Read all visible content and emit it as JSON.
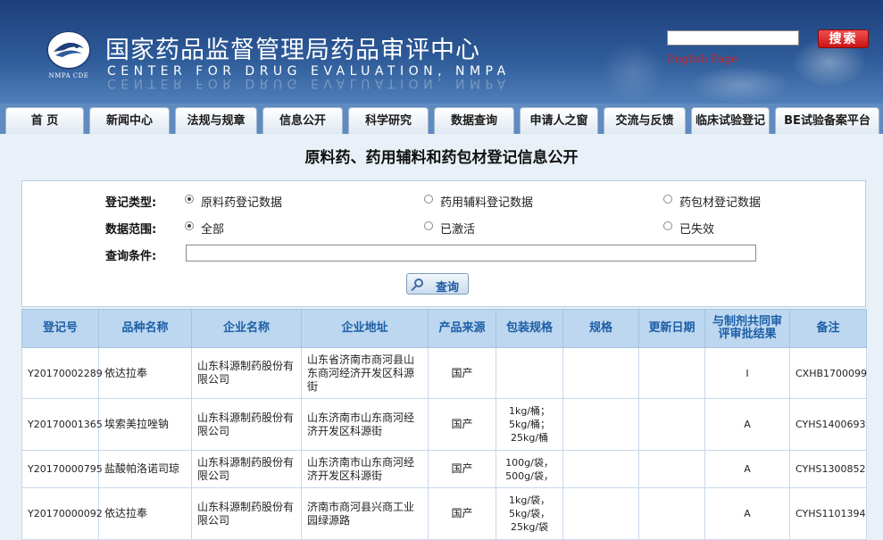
{
  "header": {
    "logo_caption": "NMPA CDE",
    "title_cn": "国家药品监督管理局药品审评中心",
    "title_en": "CENTER FOR DRUG EVALUATION, NMPA",
    "search_placeholder": "",
    "search_button": "搜索",
    "english_link": "English Page"
  },
  "nav": {
    "items": [
      "首 页",
      "新闻中心",
      "法规与规章",
      "信息公开",
      "科学研究",
      "数据查询",
      "申请人之窗",
      "交流与反馈",
      "临床试验登记",
      "BE试验备案平台"
    ]
  },
  "page_title": "原料药、药用辅料和药包材登记信息公开",
  "form": {
    "type_label": "登记类型:",
    "type_options": [
      "原料药登记数据",
      "药用辅料登记数据",
      "药包材登记数据"
    ],
    "type_selected": 0,
    "range_label": "数据范围:",
    "range_options": [
      "全部",
      "已激活",
      "已失效"
    ],
    "range_selected": 0,
    "query_label": "查询条件:",
    "query_value": "",
    "query_button": "查询"
  },
  "table": {
    "headers": [
      "登记号",
      "品种名称",
      "企业名称",
      "企业地址",
      "产品来源",
      "包装规格",
      "规格",
      "更新日期",
      "与制剂共同审评审批结果",
      "备注"
    ],
    "rows": [
      [
        "Y20170002289",
        "依达拉奉",
        "山东科源制药股份有限公司",
        "山东省济南市商河县山东商河经济开发区科源街",
        "国产",
        "",
        "",
        "",
        "I",
        "CXHB1700099"
      ],
      [
        "Y20170001365",
        "埃索美拉唑钠",
        "山东科源制药股份有限公司",
        "山东济南市山东商河经济开发区科源街",
        "国产",
        "1kg/桶；5kg/桶；25kg/桶",
        "",
        "",
        "A",
        "CYHS1400693"
      ],
      [
        "Y20170000795",
        "盐酸帕洛诺司琼",
        "山东科源制药股份有限公司",
        "山东济南市山东商河经济开发区科源街",
        "国产",
        "100g/袋，500g/袋，",
        "",
        "",
        "A",
        "CYHS1300852"
      ],
      [
        "Y20170000092",
        "依达拉奉",
        "山东科源制药股份有限公司",
        "济南市商河县兴商工业园绿源路",
        "国产",
        "1kg/袋，5kg/袋，25kg/袋",
        "",
        "",
        "A",
        "CYHS1101394"
      ]
    ]
  },
  "colors": {
    "header_blue": "#2d5a98",
    "nav_blue": "#5f8bc0",
    "search_red": "#d81e1e",
    "table_header_bg": "#bcd7ef",
    "table_header_text": "#1d5ea7"
  }
}
